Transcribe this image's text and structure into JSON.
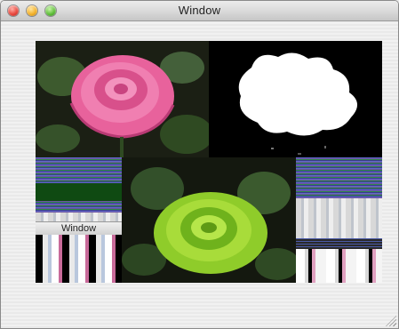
{
  "window": {
    "title": "Window",
    "buttons": {
      "close_icon": "close-traffic-light",
      "minimize_icon": "minimize-traffic-light",
      "zoom_icon": "zoom-traffic-light"
    }
  },
  "canvas": {
    "tiles": [
      {
        "name": "pink-rose-image",
        "description_icon": "photo"
      },
      {
        "name": "white-mask-image",
        "description_icon": "photo"
      },
      {
        "name": "green-rose-image",
        "description_icon": "photo"
      }
    ],
    "glitch_window_title": "Window"
  },
  "colors": {
    "pink_rose": "#e8629c",
    "green_rose": "#8fcc2a",
    "mask_white": "#ffffff",
    "background": "#101010"
  }
}
